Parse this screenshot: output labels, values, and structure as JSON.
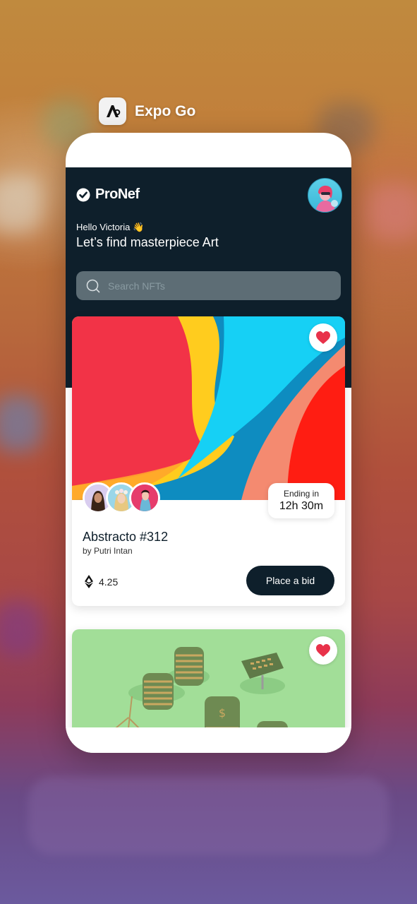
{
  "switcher": {
    "app_name": "Expo Go"
  },
  "app": {
    "brand": "ProNef",
    "greeting": "Hello Victoria 👋",
    "headline": "Let’s find masterpiece Art",
    "search": {
      "placeholder": "Search NFTs"
    }
  },
  "nfts": [
    {
      "title": "Abstracto #312",
      "author": "by Putri Intan",
      "ending_label": "Ending in",
      "ending_time": "12h 30m",
      "price": "4.25",
      "bid_label": "Place a bid",
      "favorited": true
    },
    {
      "favorited": true
    }
  ],
  "colors": {
    "header_bg": "#0e1f2b",
    "heart": "#e8324a",
    "button_bg": "#0e1f2b"
  }
}
